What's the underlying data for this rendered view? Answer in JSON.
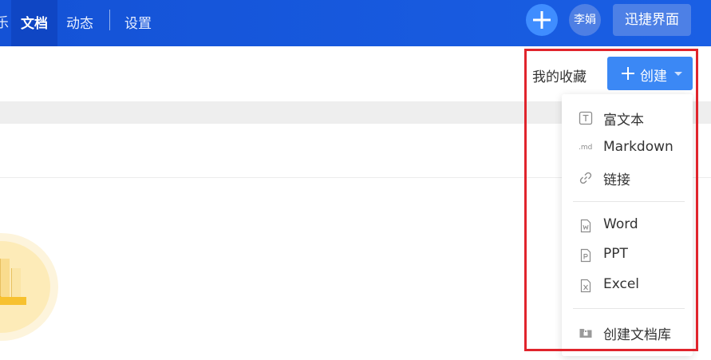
{
  "header": {
    "nav_partial": "乐",
    "nav_active": "文档",
    "nav_items": [
      "动态",
      "设置"
    ],
    "avatar_text": "李娟",
    "quick_button": "迅捷界面"
  },
  "toolbar": {
    "favorites_label": "我的收藏",
    "create_label": "创建"
  },
  "dropdown": {
    "items": [
      {
        "label": "富文本",
        "icon": "rich-text-icon"
      },
      {
        "label": "Markdown",
        "icon": "markdown-icon"
      },
      {
        "label": "链接",
        "icon": "link-icon"
      },
      {
        "label": "Word",
        "icon": "word-file-icon"
      },
      {
        "label": "PPT",
        "icon": "ppt-file-icon"
      },
      {
        "label": "Excel",
        "icon": "excel-file-icon"
      },
      {
        "label": "创建文档库",
        "icon": "folder-lock-icon"
      }
    ],
    "md_glyph": ".md"
  },
  "colors": {
    "header_bg": "#1a5fe4",
    "primary_button": "#3b88f5",
    "highlight_border": "#e0242c"
  }
}
